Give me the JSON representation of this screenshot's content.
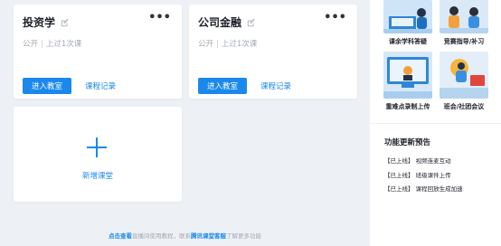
{
  "courses": [
    {
      "title": "投资学",
      "visibility": "公开",
      "last_class": "上过1次课",
      "enter_label": "进入教室",
      "record_label": "课程记录"
    },
    {
      "title": "公司金融",
      "visibility": "公开",
      "last_class": "上过1次课",
      "enter_label": "进入教室",
      "record_label": "课程记录"
    }
  ],
  "add_course": {
    "label": "新增课堂"
  },
  "footer": {
    "link1": "点击查看",
    "text1": "直播间使用教程，联系",
    "link2": "腾讯课堂客服",
    "text2": "了解更多功能"
  },
  "sidebar": {
    "features": [
      {
        "label": "课余学科答疑",
        "icon": "tutoring-illustration"
      },
      {
        "label": "竞赛指导/补习",
        "icon": "coaching-illustration"
      },
      {
        "label": "重难点录制上传",
        "icon": "recording-illustration"
      },
      {
        "label": "班会/社团会议",
        "icon": "meeting-illustration"
      }
    ],
    "updates_title": "功能更新预告",
    "updates": [
      "【已上线】 视频连麦互动",
      "【已上线】 班级课件上传",
      "【已上线】 课程回放生成加速"
    ]
  },
  "colors": {
    "accent": "#1b88ec",
    "background": "#edf1f5",
    "card": "#ffffff"
  }
}
